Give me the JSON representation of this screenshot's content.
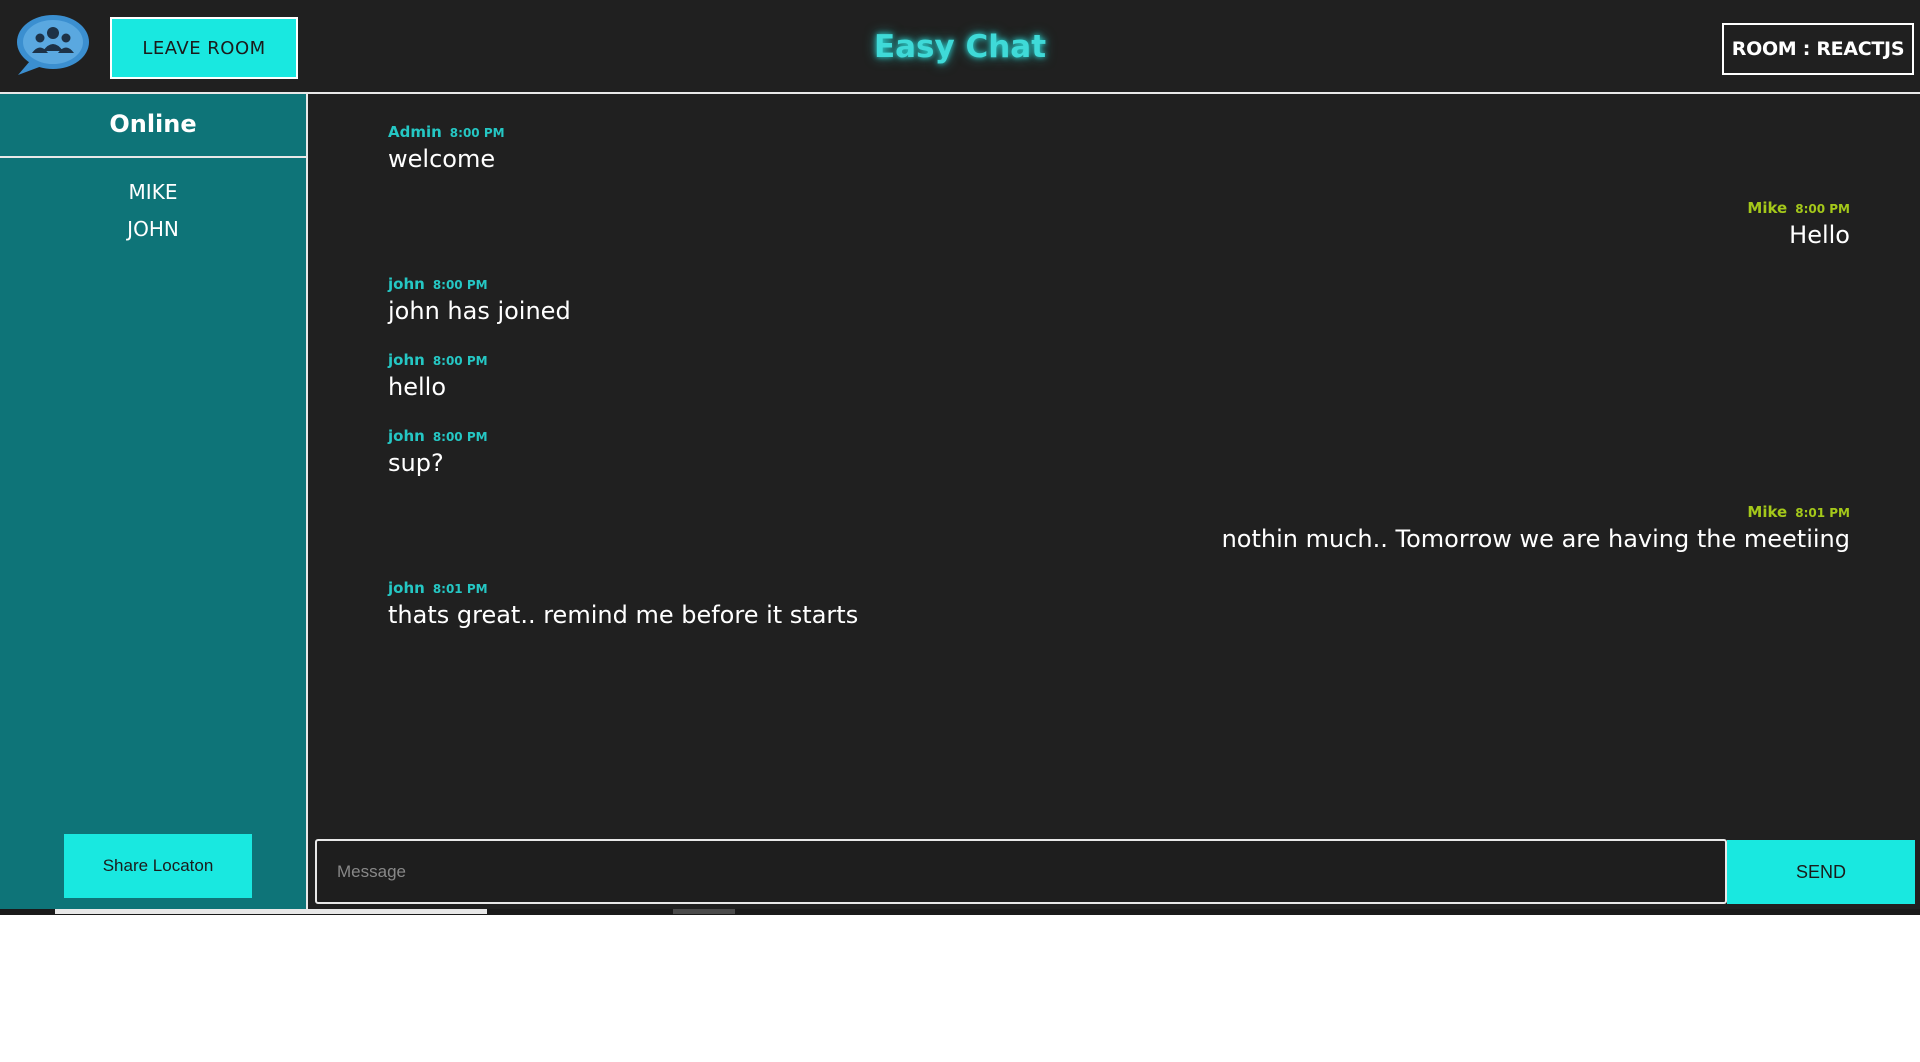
{
  "header": {
    "logo_icon": "chat-group-icon",
    "leave_label": "LEAVE ROOM",
    "title": "Easy Chat",
    "room_label": "ROOM : REACTJS"
  },
  "sidebar": {
    "title": "Online",
    "users": [
      "MIKE",
      "JOHN"
    ],
    "share_label": "Share Locaton"
  },
  "messages": [
    {
      "user": "Admin",
      "time": "8:00 PM",
      "text": "welcome",
      "side": "left"
    },
    {
      "user": "Mike",
      "time": "8:00 PM",
      "text": "Hello",
      "side": "right"
    },
    {
      "user": "john",
      "time": "8:00 PM",
      "text": "john has joined",
      "side": "left"
    },
    {
      "user": "john",
      "time": "8:00 PM",
      "text": "hello",
      "side": "left"
    },
    {
      "user": "john",
      "time": "8:00 PM",
      "text": "sup?",
      "side": "left"
    },
    {
      "user": "Mike",
      "time": "8:01 PM",
      "text": "nothin much.. Tomorrow we are having the meetiing",
      "side": "right"
    },
    {
      "user": "john",
      "time": "8:01 PM",
      "text": "thats great.. remind me before it starts",
      "side": "left"
    }
  ],
  "composer": {
    "placeholder": "Message",
    "value": "",
    "send_label": "SEND"
  },
  "colors": {
    "accent": "#19e8e0",
    "sidebar": "#0e7478",
    "background": "#202020",
    "other_user": "#25c7c4",
    "self_user": "#a4c81a"
  }
}
